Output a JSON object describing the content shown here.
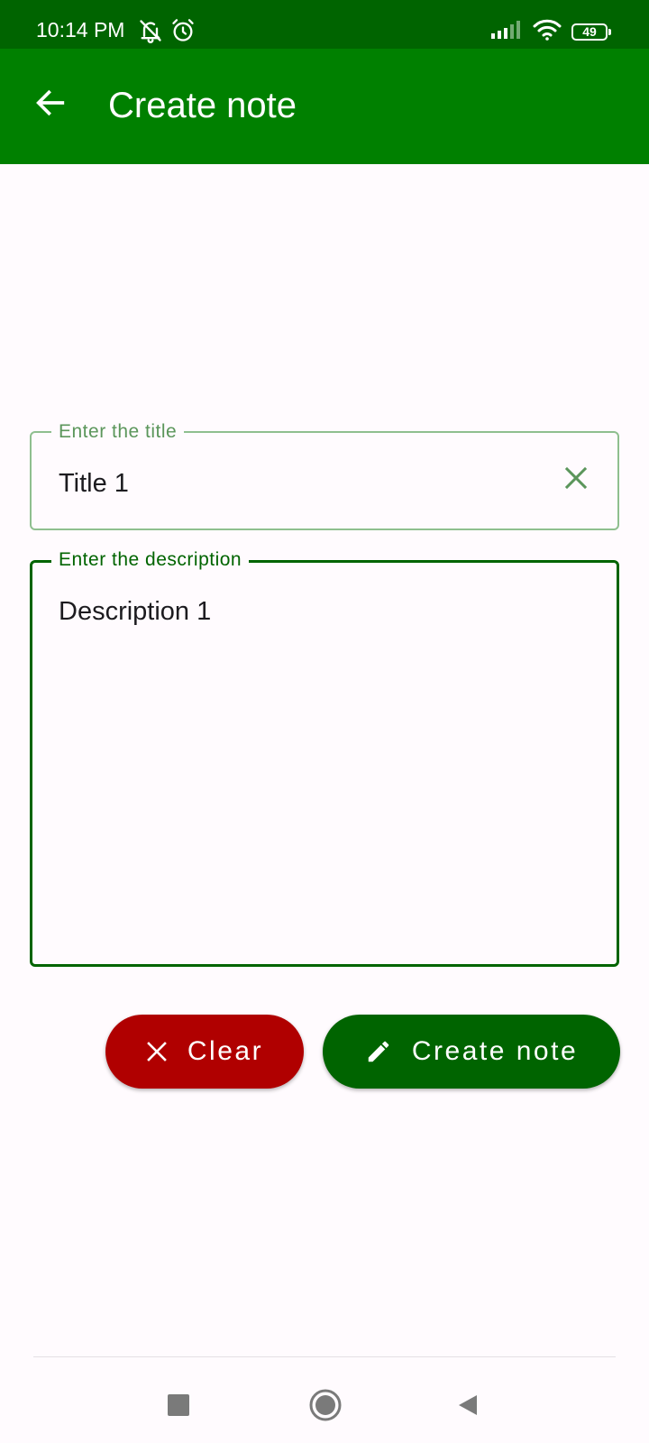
{
  "status_bar": {
    "time": "10:14 PM",
    "battery_level": "49",
    "icons": [
      "bell-off-icon",
      "alarm-icon",
      "signal-icon",
      "wifi-icon",
      "battery-icon"
    ]
  },
  "app_bar": {
    "title": "Create note",
    "back_icon": "arrow-left-icon"
  },
  "form": {
    "title_field": {
      "label": "Enter the title",
      "value": "Title 1",
      "trailing_icon": "close-icon"
    },
    "description_field": {
      "label": "Enter the description",
      "value": "Description 1"
    }
  },
  "actions": {
    "clear_label": "Clear",
    "clear_icon": "close-icon",
    "create_label": "Create note",
    "create_icon": "pencil-icon"
  },
  "nav": {
    "recents_icon": "square-icon",
    "home_icon": "circle-icon",
    "back_icon": "triangle-back-icon"
  },
  "colors": {
    "status_bar": "#006400",
    "app_bar": "#008000",
    "clear_button": "#b00000",
    "create_button": "#006400",
    "focused_border": "#006400",
    "unfocused_border": "#8fbf8f"
  }
}
